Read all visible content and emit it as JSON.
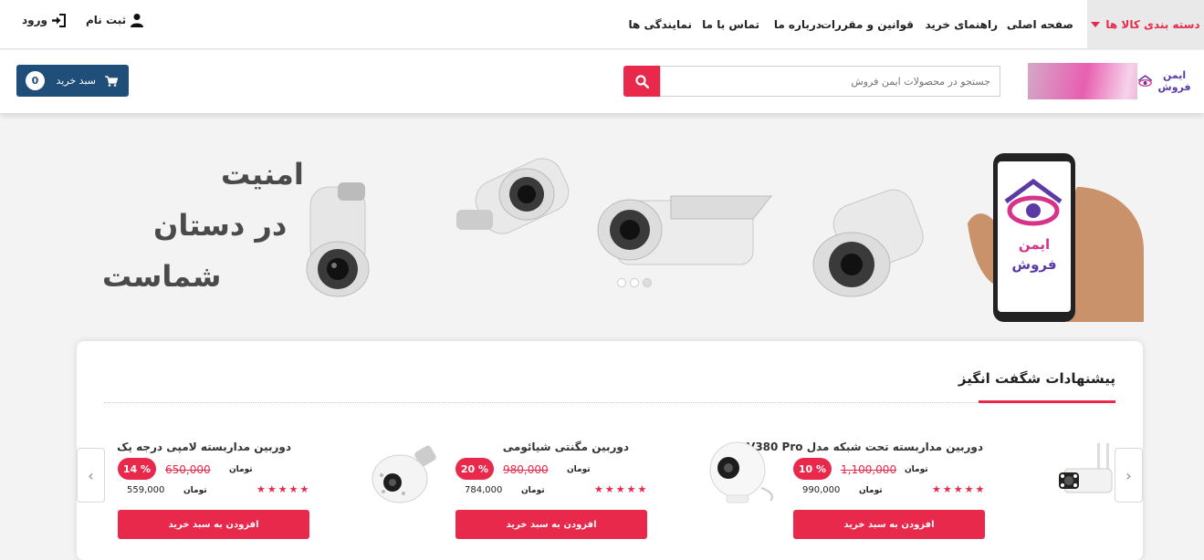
{
  "nav": {
    "category_label": "دسته بندی کالا ها",
    "links": [
      "صفحه اصلی",
      "راهنمای خرید",
      "قوانین و مقررات",
      "درباره ما",
      "تماس با ما",
      "نمایندگی ها"
    ],
    "register": "ثبت نام",
    "login": "ورود"
  },
  "header": {
    "logo_text": "ایمن فروش",
    "search_placeholder": "جستجو در محصولات ایمن فروش",
    "cart_label": "سبد خرید",
    "cart_count": "0"
  },
  "banner": {
    "slogan_line1": "امنیت",
    "slogan_line2": "در دستان",
    "slogan_line3": "شماست",
    "phone_text_line1": "ایمن",
    "phone_text_line2": "فروش",
    "slide_count": 3,
    "active_slide": 3
  },
  "offers": {
    "title": "پیشنهادات شگفت انگیز",
    "add_to_cart_label": "افزودن به سبد خرید",
    "currency": "تومان",
    "products": [
      {
        "name": "دوربین مداربسته تحت شبکه مدل V380 Pro",
        "old_price": "1,100,000",
        "discount": "10 %",
        "price": "990,000",
        "rating": 5
      },
      {
        "name": "دوربین مگنتی شیائومی",
        "old_price": "980,000",
        "discount": "20 %",
        "price": "784,000",
        "rating": 5
      },
      {
        "name": "دوربین مداربسته لامپی درجه یک",
        "old_price": "650,000",
        "discount": "14 %",
        "price": "559,000",
        "rating": 5
      }
    ]
  },
  "colors": {
    "accent": "#e8294c",
    "cart_button": "#1f4e79"
  }
}
